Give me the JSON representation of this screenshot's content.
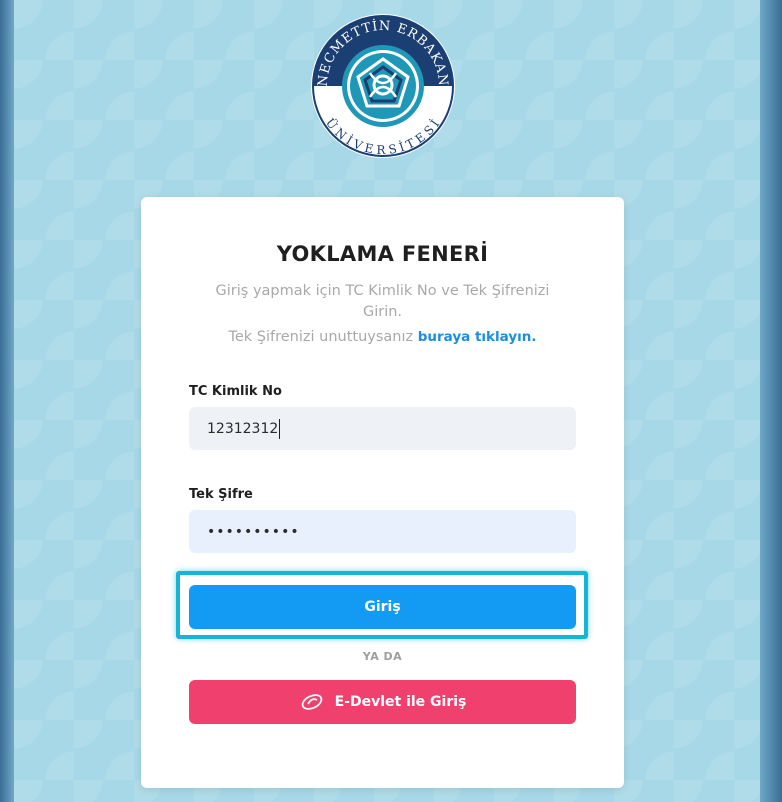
{
  "logo": {
    "top_text": "NECMETTİN ERBAKAN",
    "bottom_text": "ÜNİVERSİTESİ"
  },
  "card": {
    "title": "YOKLAMA FENERİ",
    "subtitle": "Giriş yapmak için TC Kimlik No ve Tek Şifrenizi Girin.",
    "forgot_prefix": "Tek Şifrenizi unuttuysanız ",
    "forgot_link": "buraya tıklayın."
  },
  "form": {
    "tc_label": "TC Kimlik No",
    "tc_value": "12312312",
    "password_label": "Tek Şifre",
    "password_value": "••••••••••",
    "login_button": "Giriş",
    "or_text": "YA DA",
    "edevlet_button": "E-Devlet ile Giriş"
  },
  "colors": {
    "background": "#a7d8e7",
    "primary": "#139bf4",
    "edevlet": "#f0406d",
    "highlight": "#17b4d4",
    "link": "#1b8ee0"
  }
}
